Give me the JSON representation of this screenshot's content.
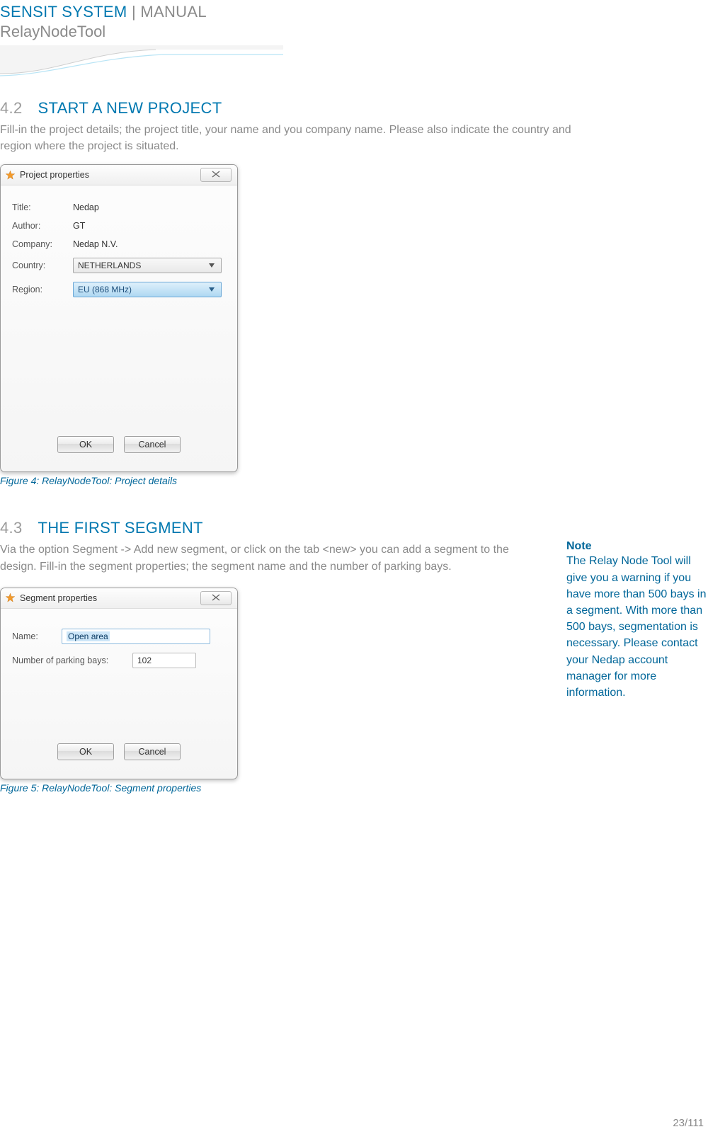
{
  "header": {
    "title_prefix": "SENSIT SYSTEM",
    "title_sep": " | ",
    "title_suffix": "MANUAL",
    "subtitle": "RelayNodeTool"
  },
  "section42": {
    "number": "4.2",
    "title": "START A NEW PROJECT",
    "body": "Fill-in the project details; the project title, your name and you company name. Please also indicate the country and region where the project is situated.",
    "dialog_title": "Project properties",
    "labels": {
      "title": "Title:",
      "author": "Author:",
      "company": "Company:",
      "country": "Country:",
      "region": "Region:"
    },
    "values": {
      "title": "Nedap",
      "author": "GT",
      "company": "Nedap N.V.",
      "country": "NETHERLANDS",
      "region": "EU (868 MHz)"
    },
    "buttons": {
      "ok": "OK",
      "cancel": "Cancel"
    },
    "caption": "Figure 4: RelayNodeTool: Project details"
  },
  "section43": {
    "number": "4.3",
    "title": "THE FIRST SEGMENT",
    "body": "Via the option Segment -> Add new segment, or click on the tab <new> you can add a segment to the design. Fill-in the segment properties; the segment name and the number of parking bays.",
    "dialog_title": "Segment properties",
    "labels": {
      "name": "Name:",
      "bays": "Number of parking bays:"
    },
    "values": {
      "name": "Open area",
      "bays": "102"
    },
    "buttons": {
      "ok": "OK",
      "cancel": "Cancel"
    },
    "caption": "Figure 5: RelayNodeTool: Segment properties",
    "note_title": "Note",
    "note_body": "The Relay Node Tool will give you a warning if you have more than 500 bays in a segment. With more than 500 bays, segmentation is necessary. Please contact your Nedap account manager for more information."
  },
  "footer": {
    "page": "23/111"
  }
}
